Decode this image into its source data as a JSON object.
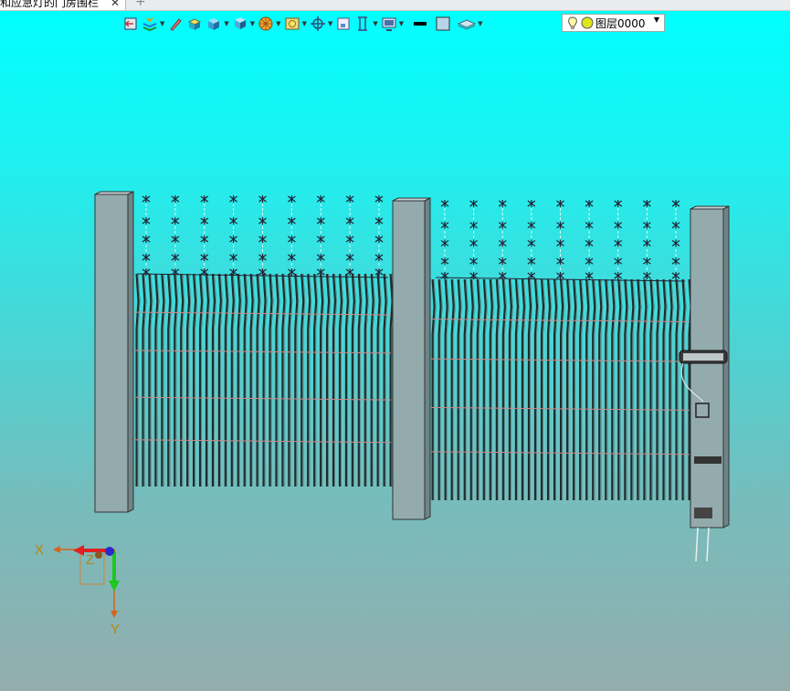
{
  "tab": {
    "title": "和应急灯的门房围栏",
    "close_glyph": "✕",
    "add_glyph": "+"
  },
  "toolbar": {
    "items": [
      {
        "icon": "window-back-icon",
        "dropdown": false
      },
      {
        "icon": "layers-stack-icon",
        "dropdown": true
      },
      {
        "icon": "pen-icon",
        "dropdown": false
      },
      {
        "icon": "box-yellow-icon",
        "dropdown": false
      },
      {
        "icon": "cube-icon",
        "dropdown": true
      },
      {
        "icon": "cube-view-icon",
        "dropdown": true
      },
      {
        "icon": "render-sphere-icon",
        "dropdown": true
      },
      {
        "icon": "picture-frame-icon",
        "dropdown": true
      },
      {
        "icon": "snap-target-icon",
        "dropdown": true
      },
      {
        "icon": "fit-window-icon",
        "dropdown": false
      },
      {
        "icon": "section-icon",
        "dropdown": true
      },
      {
        "icon": "monitor-icon",
        "dropdown": true
      },
      {
        "icon": "line-weight-icon",
        "dropdown": false
      },
      {
        "icon": "color-swatch-icon",
        "dropdown": false
      },
      {
        "icon": "layer-plane-icon",
        "dropdown": true
      }
    ],
    "layer": {
      "value": "图层0000",
      "dropdown_glyph": "▼"
    }
  },
  "axes": {
    "x_label": "X",
    "y_label": "Y",
    "z_label": "Z"
  },
  "colors": {
    "sky_top": "#00ffff",
    "sky_bottom": "#94adad",
    "post": "#94abae",
    "bar": "#1e2d2d",
    "rail": "#c98c8c"
  }
}
